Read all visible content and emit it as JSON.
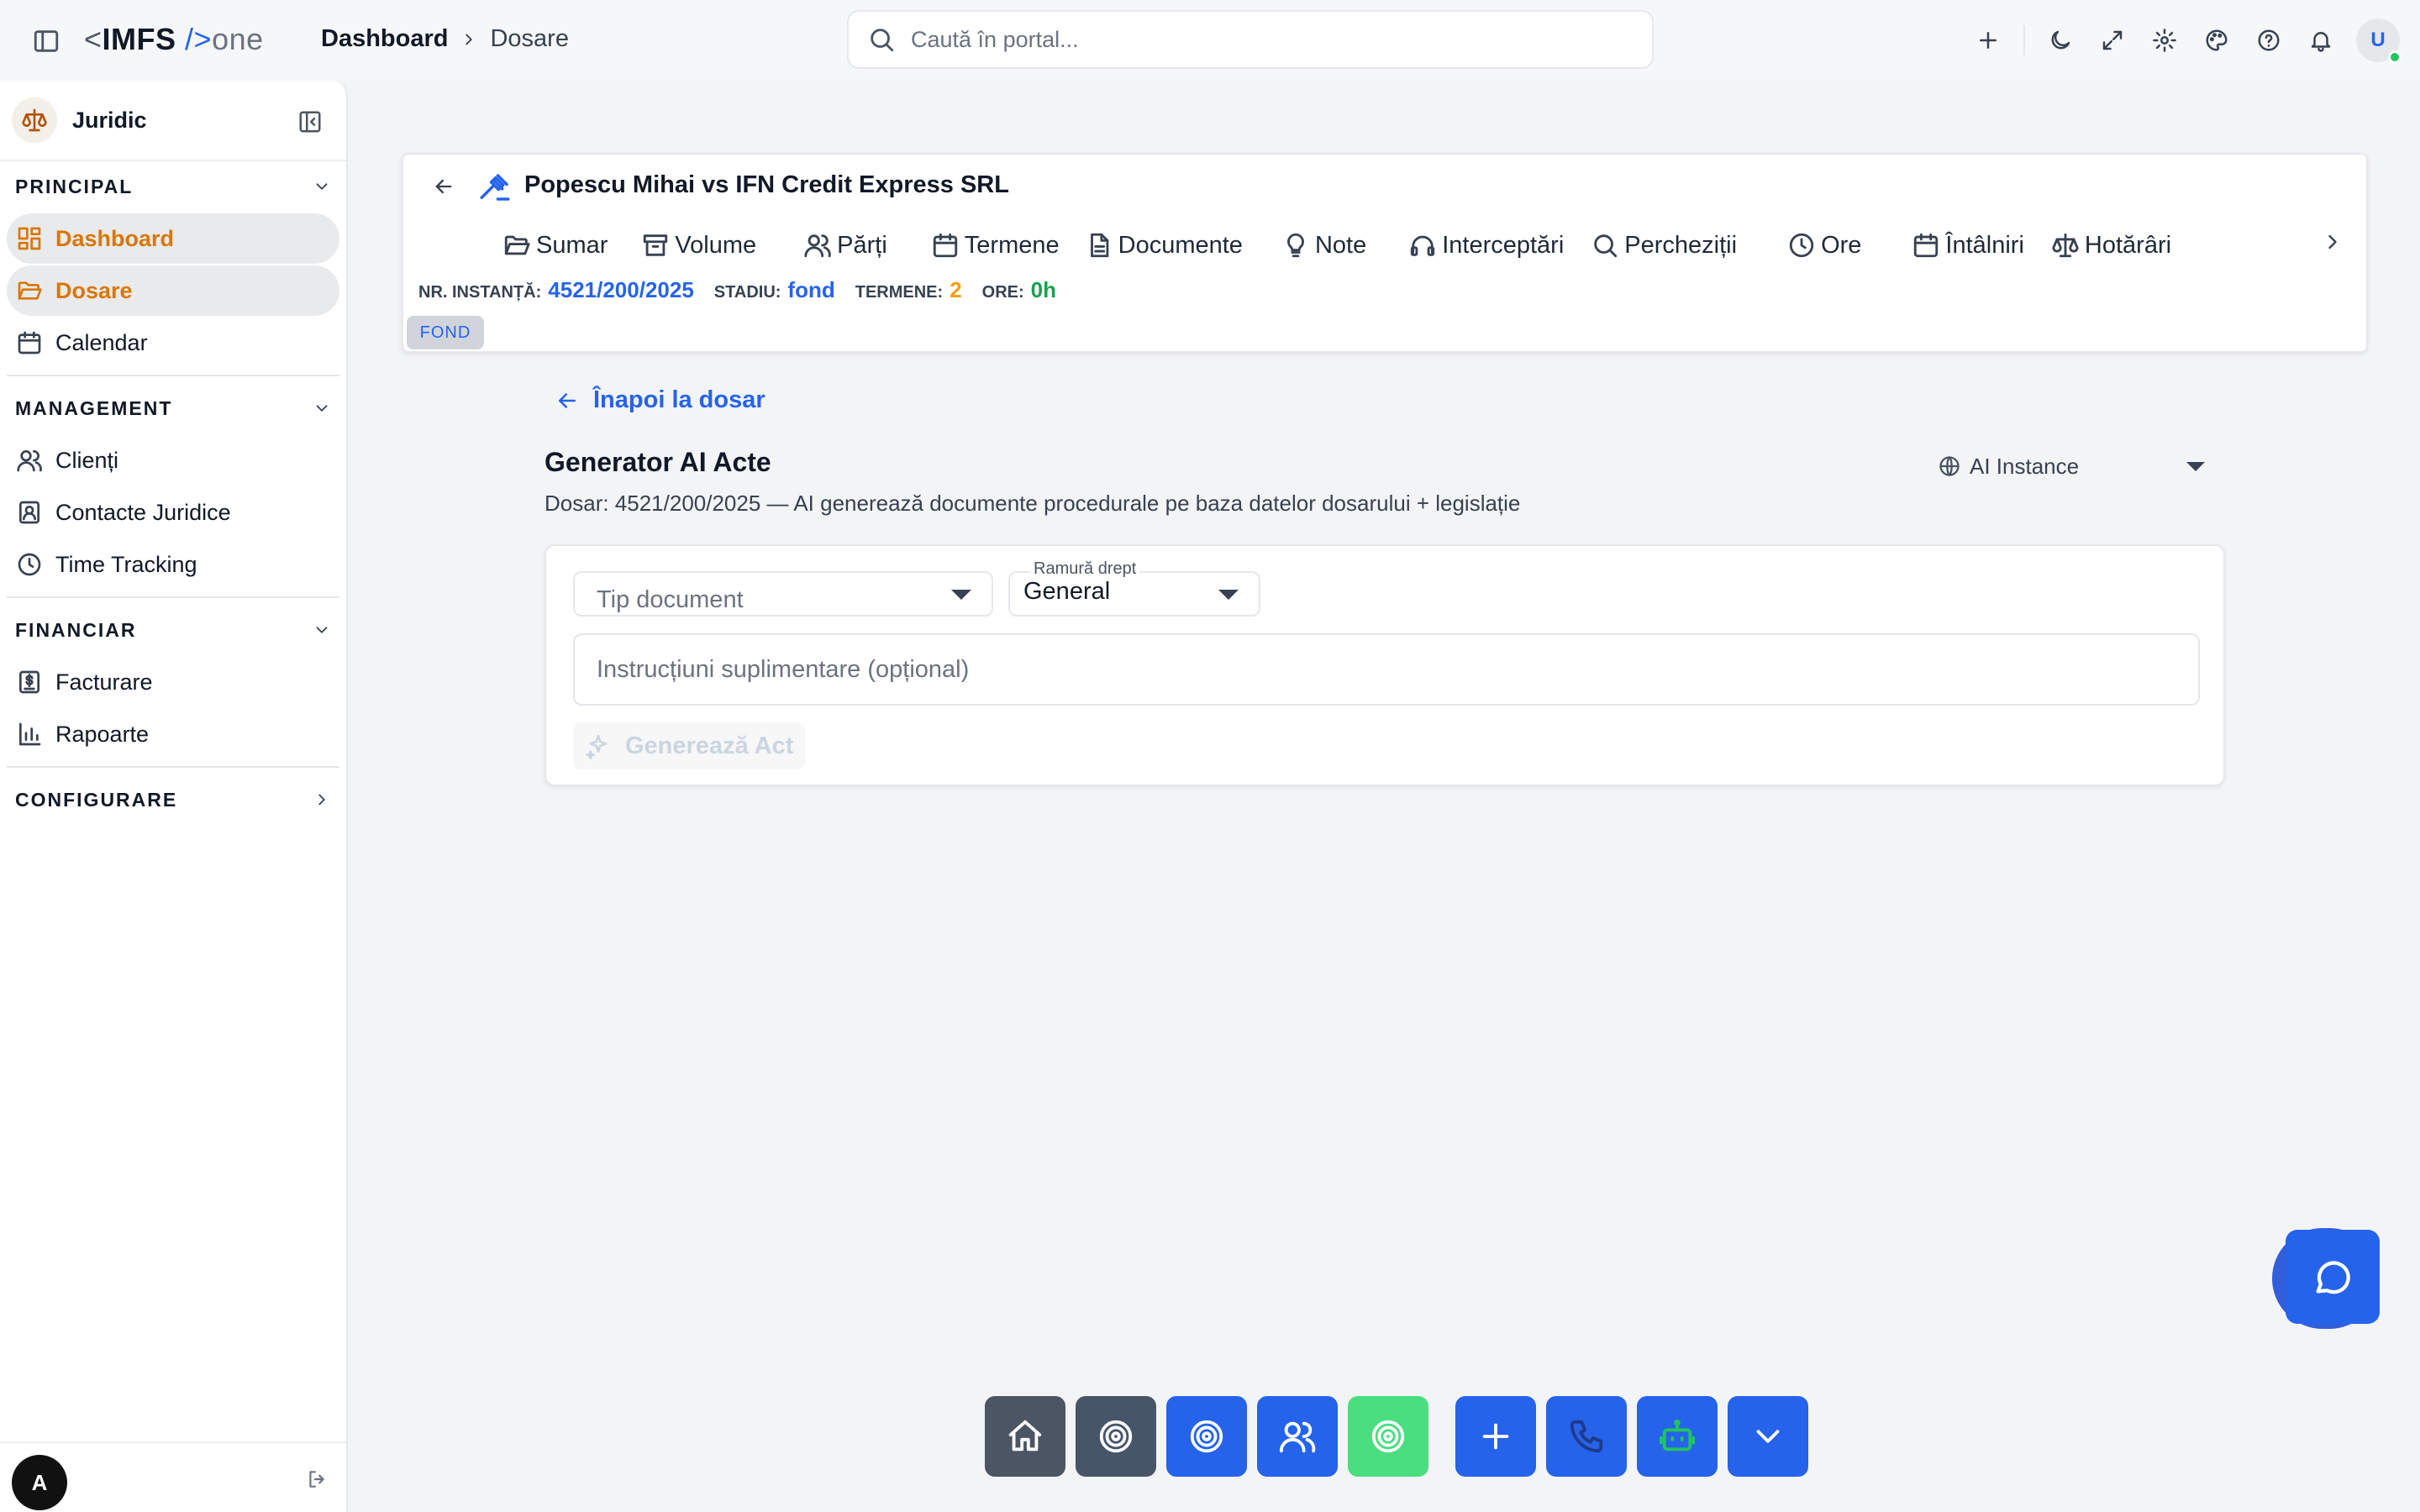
{
  "app": {
    "logo": {
      "lt": "<",
      "name": "IMFS",
      "slash": "/>",
      "suffix": "one"
    },
    "breadcrumb": [
      "Dashboard",
      "Dosare"
    ],
    "search_placeholder": "Caută în portal...",
    "user_initial": "U"
  },
  "sidebar": {
    "title": "Juridic",
    "sections": {
      "principal": "PRINCIPAL",
      "management": "MANAGEMENT",
      "financiar": "FINANCIAR",
      "configurare": "CONFIGURARE"
    },
    "items": {
      "dashboard": "Dashboard",
      "dosare": "Dosare",
      "calendar": "Calendar",
      "clienti": "Clienți",
      "contacte": "Contacte Juridice",
      "time": "Time Tracking",
      "facturare": "Facturare",
      "rapoarte": "Rapoarte"
    },
    "user_initial": "A"
  },
  "case": {
    "title": "Popescu Mihai vs IFN Credit Express SRL",
    "tabs": [
      "Sumar",
      "Volume",
      "Părți",
      "Termene",
      "Documente",
      "Note",
      "Interceptări",
      "Percheziții",
      "Ore",
      "Întâlniri",
      "Hotărâri"
    ],
    "meta": {
      "nr_label": "NR. INSTANȚĂ:",
      "nr_value": "4521/200/2025",
      "stadiu_label": "STADIU:",
      "stadiu_value": "fond",
      "termene_label": "TERMENE:",
      "termene_value": "2",
      "ore_label": "ORE:",
      "ore_value": "0h"
    },
    "badge": "FOND"
  },
  "generator": {
    "back_label": "Înapoi la dosar",
    "title": "Generator AI Acte",
    "subtitle": "Dosar: 4521/200/2025 — AI generează documente procedurale pe baza datelor dosarului + legislație",
    "ai_instance": "AI Instance",
    "doc_type_placeholder": "Tip document",
    "ramura_label": "Ramură drept",
    "ramura_value": "General",
    "instructions_placeholder": "Instrucțiuni suplimentare (opțional)",
    "generate_label": "Generează Act"
  },
  "colors": {
    "accent": "#2563eb",
    "active_nav": "#d97706",
    "success": "#16a34a",
    "warning": "#f59e0b"
  }
}
